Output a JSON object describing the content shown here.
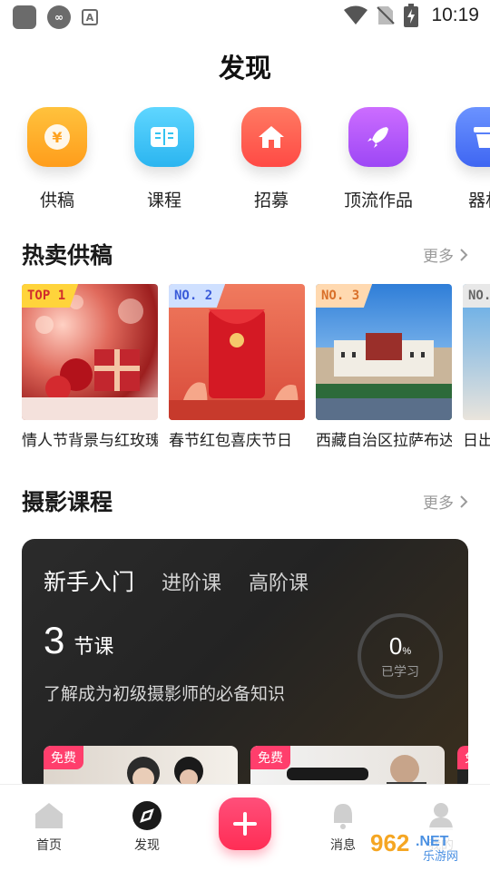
{
  "status_bar": {
    "time": "10:19"
  },
  "page": {
    "title": "发现"
  },
  "categories": [
    {
      "label": "供稿",
      "icon": "yuan-icon",
      "color": "#ffb020"
    },
    {
      "label": "课程",
      "icon": "book-icon",
      "color": "#34c3f0"
    },
    {
      "label": "招募",
      "icon": "home-icon",
      "color": "#ff5a4e"
    },
    {
      "label": "顶流作品",
      "icon": "rocket-icon",
      "color": "#b65cff"
    },
    {
      "label": "器材",
      "icon": "equipment-icon",
      "color": "#4f7cff"
    }
  ],
  "hot": {
    "title": "热卖供稿",
    "more": "更多",
    "items": [
      {
        "rank": "TOP 1",
        "title": "情人节背景与红玫瑰",
        "badge_bg": "#ffd43b",
        "badge_fg": "#d12d2d"
      },
      {
        "rank": "NO. 2",
        "title": "春节红包喜庆节日",
        "badge_bg": "#cfe0ff",
        "badge_fg": "#3a5bd9"
      },
      {
        "rank": "NO. 3",
        "title": "西藏自治区拉萨布达拉宫",
        "badge_bg": "#ffd9b0",
        "badge_fg": "#d9702a"
      },
      {
        "rank": "NO.",
        "title": "日出",
        "badge_bg": "#e8e8e8",
        "badge_fg": "#666666"
      }
    ]
  },
  "course": {
    "title": "摄影课程",
    "more": "更多",
    "tabs": [
      "新手入门",
      "进阶课",
      "高阶课"
    ],
    "lesson_count": "3",
    "lesson_unit": "节课",
    "description": "了解成为初级摄影师的必备知识",
    "progress_value": "0",
    "progress_unit": "%",
    "progress_label": "已学习",
    "progress_fraction": 0,
    "thumbs": [
      {
        "tag": "免费"
      },
      {
        "tag": "免费"
      },
      {
        "tag": "免"
      }
    ]
  },
  "nav": {
    "items": [
      {
        "label": "首页"
      },
      {
        "label": "发现"
      },
      {
        "label": "消息"
      },
      {
        "label": "我的"
      }
    ]
  },
  "watermark": {
    "text": "962",
    "suffix": ".NET",
    "sub": "乐游网"
  }
}
